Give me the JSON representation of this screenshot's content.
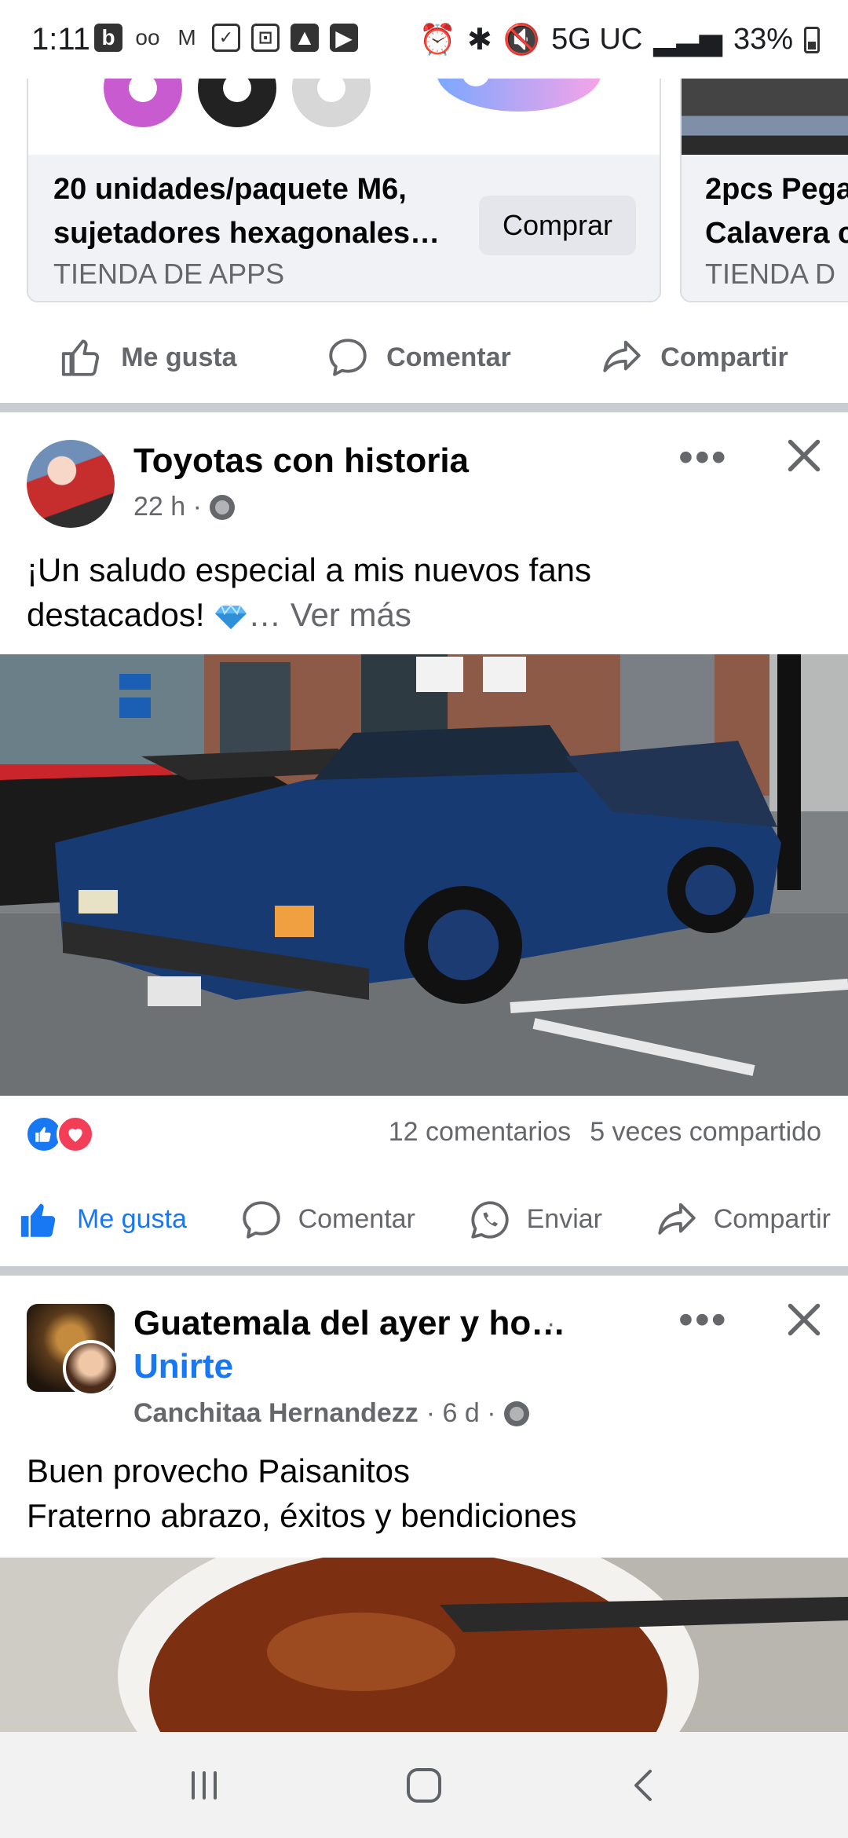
{
  "status_bar": {
    "time": "1:11",
    "network": "5G UC",
    "battery": "33%"
  },
  "shop": {
    "cards": [
      {
        "title": "20 unidades/paquete M6,\nsujetadores hexagonales…",
        "store": "TIENDA DE APPS",
        "button": "Comprar"
      },
      {
        "title": "2pcs Pega\nCalavera c",
        "store": "TIENDA D"
      }
    ]
  },
  "actions_top": {
    "like": "Me gusta",
    "comment": "Comentar",
    "share": "Compartir"
  },
  "post1": {
    "author": "Toyotas con historia",
    "time": "22 h ·",
    "text": "¡Un saludo especial a mis nuevos fans\ndestacados! ",
    "see_more": "… Ver más",
    "comments": "12 comentarios",
    "shares": "5 veces compartido",
    "actions": {
      "like": "Me gusta",
      "comment": "Comentar",
      "send": "Enviar",
      "share": "Compartir"
    }
  },
  "post2": {
    "group": "Guatemala del ayer y ho…",
    "separator": "·",
    "join": "Unirte",
    "author": "Canchitaa Hernandezz",
    "time": "· 6 d ·",
    "text": "Buen provecho Paisanitos\nFraterno abrazo, éxitos y bendiciones"
  },
  "colors": {
    "accent": "#1877f2",
    "text_secondary": "#65676b",
    "love": "#f33e58"
  }
}
